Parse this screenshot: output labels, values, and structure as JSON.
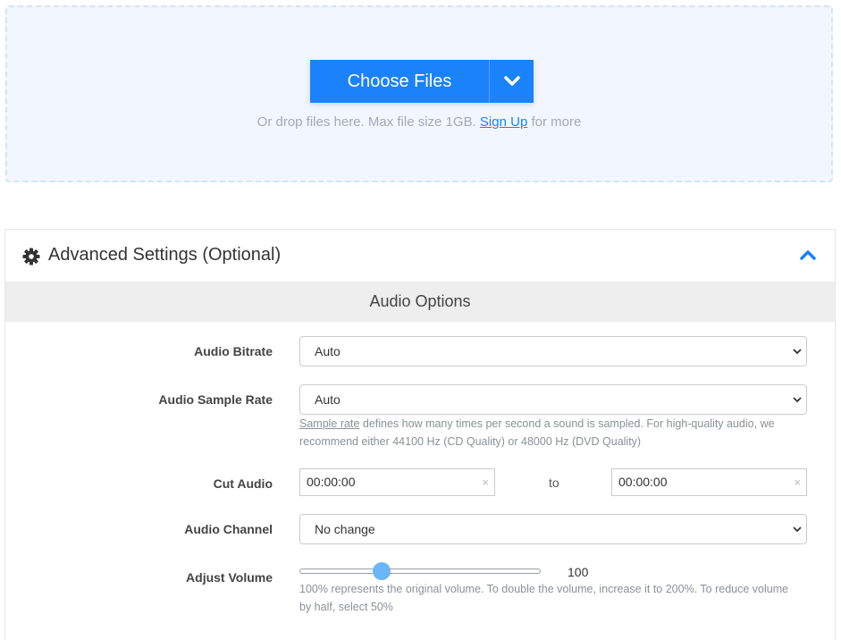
{
  "upload": {
    "choose_label": "Choose Files",
    "hint_prefix": "Or drop files here. Max file size 1GB.",
    "signup_link": "Sign Up",
    "hint_suffix": "for more"
  },
  "advanced": {
    "title": "Advanced Settings (Optional)",
    "section_title": "Audio Options",
    "bitrate": {
      "label": "Audio Bitrate",
      "value": "Auto"
    },
    "sample_rate": {
      "label": "Audio Sample Rate",
      "value": "Auto",
      "help_link": "Sample rate",
      "help_text": " defines how many times per second a sound is sampled. For high-quality audio, we recommend either 44100 Hz (CD Quality) or 48000 Hz (DVD Quality)"
    },
    "cut_audio": {
      "label": "Cut Audio",
      "start": "00:00:00",
      "to": "to",
      "end": "00:00:00",
      "clear": "×"
    },
    "channel": {
      "label": "Audio Channel",
      "value": "No change"
    },
    "volume": {
      "label": "Adjust Volume",
      "value": "100",
      "help": "100% represents the original volume. To double the volume, increase it to 200%. To reduce volume by half, select 50%"
    }
  },
  "colors": {
    "accent": "#1a82fb",
    "dropzone_bg": "#f2f6fe",
    "section_bg": "#eeeeee"
  },
  "icons": {
    "caret": "chevron-down-icon",
    "gear": "gear-icon",
    "collapse": "chevron-up-icon"
  }
}
